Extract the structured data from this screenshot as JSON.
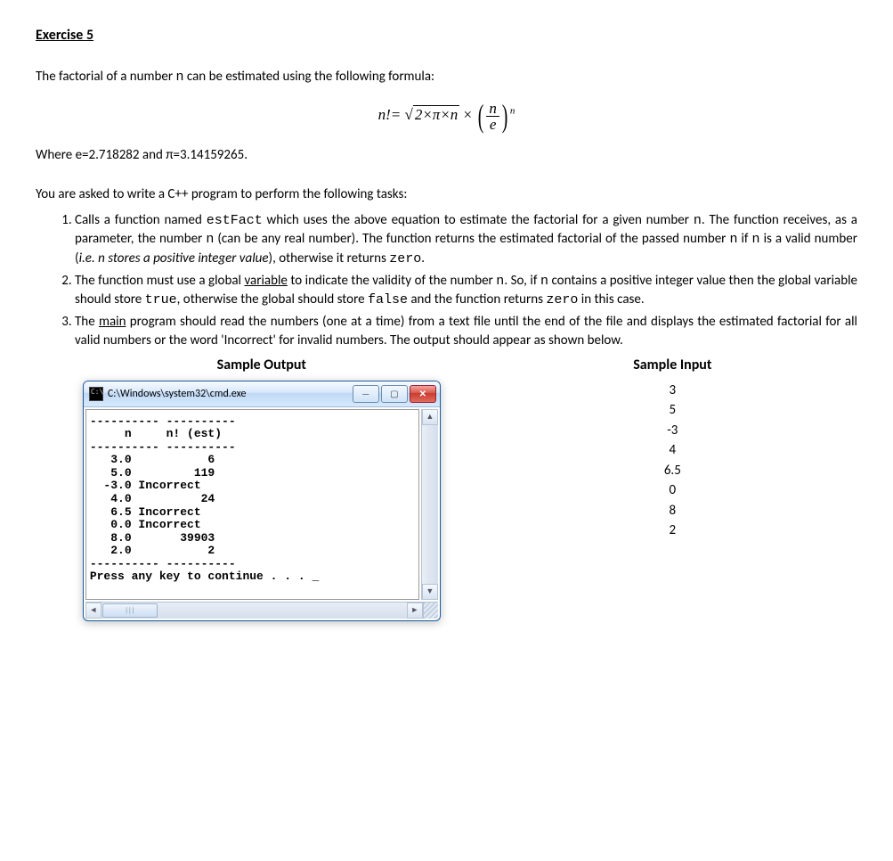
{
  "title": "Exercise 5",
  "intro_part1": "The factorial of a number ",
  "intro_code1": "n",
  "intro_part2": " can be estimated using the following formula:",
  "formula": {
    "lhs": "n!=",
    "sqrt_sym": "√",
    "under_sqrt": "2×π×n",
    "times": " × ",
    "frac_num": "n",
    "frac_den": "e",
    "exp": "n"
  },
  "constants": "Where e=2.718282 and π=3.14159265.",
  "tasks_intro": "You are asked to write a C++ program to perform the following tasks:",
  "task1": {
    "a": "Calls a function named ",
    "code1": "estFact",
    "b": " which uses the above equation to estimate the factorial for a given number ",
    "code2": "n",
    "c": ". The function receives, as a parameter, the number ",
    "code3": "n",
    "d": " (can be any real number). The function returns the estimated factorial of the passed number ",
    "code4": "n",
    "e": "  if ",
    "code5": "n",
    "f": "  is a valid number (",
    "ital": "i.e. n stores a positive integer value",
    "g": "), otherwise it returns ",
    "code6": "zero",
    "h": "."
  },
  "task2": {
    "a": "The function must use a global ",
    "u": "variable",
    "b": " to indicate the validity of the number ",
    "code1": "n",
    "c": ". So, if ",
    "code2": "n",
    "d": " contains a positive integer value then the global variable should store ",
    "code3": "true",
    "e": ", otherwise the global should store ",
    "code4": "false",
    "f": "  and the function returns  ",
    "code5": "zero",
    "g": "  in this case."
  },
  "task3": {
    "a": "The ",
    "u": "main",
    "b": " program should read the numbers (one at a time) from a text file until the end of the file and displays the estimated factorial for all valid numbers or the word 'Incorrect' for invalid numbers. The output should appear as shown below."
  },
  "sample_output_heading": "Sample Output",
  "sample_input_heading": "Sample Input",
  "cmd": {
    "icon_text": "C:\\",
    "title": "C:\\Windows\\system32\\cmd.exe",
    "header": "     n     n! (est)",
    "rows": [
      "   3.0           6",
      "   5.0         119",
      "  -3.0 Incorrect",
      "   4.0          24",
      "   6.5 Incorrect",
      "   0.0 Incorrect",
      "   8.0       39903",
      "   2.0           2"
    ],
    "footer": "Press any key to continue . . . _"
  },
  "sample_input": [
    "3",
    "5",
    "-3",
    "4",
    "6.5",
    "0",
    "8",
    "2"
  ],
  "chart_data": {
    "type": "table",
    "title": "Sample Output (estimated factorial)",
    "columns": [
      "n",
      "n! (est)"
    ],
    "rows": [
      [
        "3.0",
        "6"
      ],
      [
        "5.0",
        "119"
      ],
      [
        "-3.0",
        "Incorrect"
      ],
      [
        "4.0",
        "24"
      ],
      [
        "6.5",
        "Incorrect"
      ],
      [
        "0.0",
        "Incorrect"
      ],
      [
        "8.0",
        "39903"
      ],
      [
        "2.0",
        "2"
      ]
    ],
    "sample_input": [
      3,
      5,
      -3,
      4,
      6.5,
      0,
      8,
      2
    ]
  }
}
